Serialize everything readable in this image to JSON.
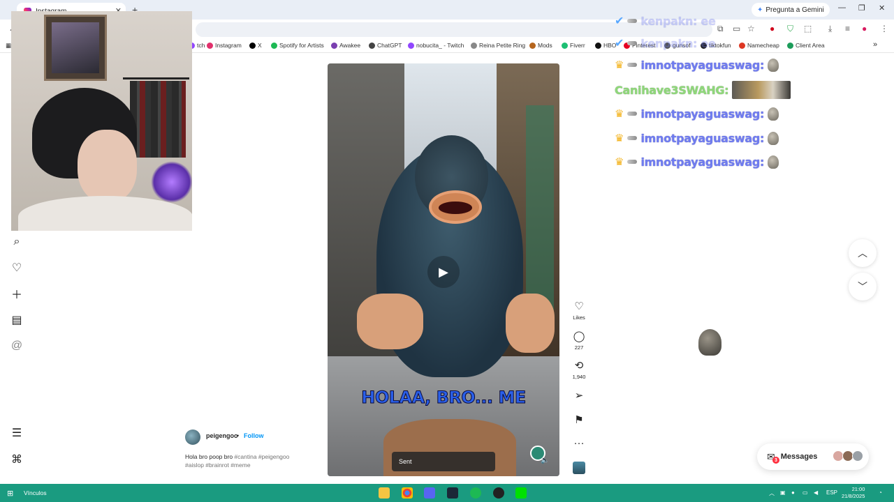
{
  "browser": {
    "tab_title": "Instagram",
    "new_tab_icon": "plus",
    "gemini_label": "Pregunta a Gemini",
    "bookmarks": [
      {
        "label": "tch",
        "color": "#9146ff"
      },
      {
        "label": "Instagram",
        "color": "#e1306c"
      },
      {
        "label": "X",
        "color": "#000000"
      },
      {
        "label": "Spotify for Artists",
        "color": "#1db954"
      },
      {
        "label": "Awakee",
        "color": "#7a3fb0"
      },
      {
        "label": "ChatGPT",
        "color": "#444444"
      },
      {
        "label": "nobucita_ - Twitch",
        "color": "#9146ff"
      },
      {
        "label": "Reina Petite Ring",
        "color": "#888888"
      },
      {
        "label": "Mods",
        "color": "#b5651d"
      },
      {
        "label": "Fiverr",
        "color": "#1dbf73"
      },
      {
        "label": "HBO",
        "color": "#111111"
      },
      {
        "label": "Pinterest",
        "color": "#e60023"
      },
      {
        "label": "gunsof",
        "color": "#555555"
      },
      {
        "label": "tiktokfun",
        "color": "#222222"
      },
      {
        "label": "Namecheap",
        "color": "#de3723"
      },
      {
        "label": "Client Area",
        "color": "#1c9c5a"
      }
    ]
  },
  "chat": {
    "faded_rows": [
      {
        "name": "kenpakn: ee"
      },
      {
        "name": "kenpakn: ee"
      }
    ],
    "rows": [
      {
        "name": "imnotpayaguaswag:",
        "kind": "crown-skull"
      },
      {
        "name": "Canihave3SWAHG:",
        "kind": "green-emote"
      },
      {
        "name": "imnotpayaguaswag:",
        "kind": "crown-skull"
      },
      {
        "name": "imnotpayaguaswag:",
        "kind": "crown-skull"
      },
      {
        "name": "imnotpayaguaswag:",
        "kind": "crown-skull"
      }
    ]
  },
  "sidebar": {
    "icons": [
      "search-icon",
      "heart-icon",
      "create-icon",
      "dashboard-icon",
      "threads-icon",
      "menu-icon",
      "more-icon"
    ]
  },
  "reel": {
    "caption_overlay": "HOLAA, BRO... ME",
    "sent_label": "Sent",
    "author": "peigengoo",
    "separator": "•",
    "follow_label": "Follow",
    "description_text": "Hola bro poop bro",
    "hashtags_line1": "#cantina #peigengoo",
    "hashtags_line2": "#aislop #brainrot #meme"
  },
  "actions": {
    "likes_label": "Likes",
    "comments_count": "227",
    "reposts_count": "1,940"
  },
  "messages": {
    "label": "Messages",
    "badge": "3"
  },
  "taskbar": {
    "links_label": "Vínculos",
    "lang": "ESP",
    "time": "21:00",
    "date": "21/8/2025"
  }
}
